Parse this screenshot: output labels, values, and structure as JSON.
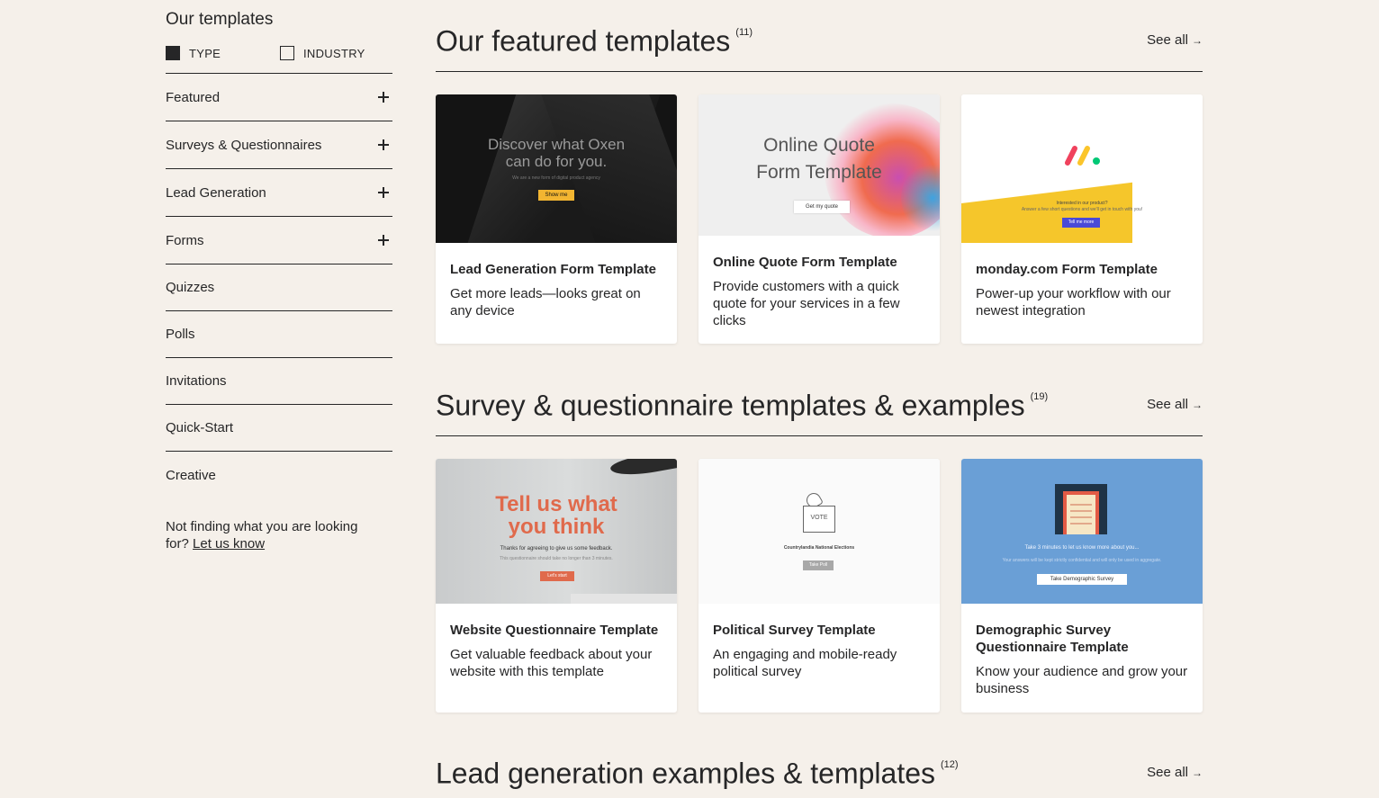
{
  "sidebar": {
    "title": "Our templates",
    "toggles": [
      {
        "label": "TYPE",
        "checked": true
      },
      {
        "label": "INDUSTRY",
        "checked": false
      }
    ],
    "categories": [
      {
        "label": "Featured",
        "expandable": true
      },
      {
        "label": "Surveys & Questionnaires",
        "expandable": true
      },
      {
        "label": "Lead Generation",
        "expandable": true
      },
      {
        "label": "Forms",
        "expandable": true
      },
      {
        "label": "Quizzes",
        "expandable": false
      },
      {
        "label": "Polls",
        "expandable": false
      },
      {
        "label": "Invitations",
        "expandable": false
      },
      {
        "label": "Quick-Start",
        "expandable": false
      },
      {
        "label": "Creative",
        "expandable": false
      }
    ],
    "not_finding_text": "Not finding what you are looking for?",
    "let_us_know": "Let us know"
  },
  "sections": [
    {
      "title": "Our featured templates",
      "count": "(11)",
      "see_all": "See all",
      "cards": [
        {
          "title": "Lead Generation Form Template",
          "desc": "Get more leads—looks great on any device",
          "thumb": {
            "headline": "Discover what Oxen can do for you.",
            "sub": "We are a new form of digital product agency",
            "button": "Show me"
          }
        },
        {
          "title": "Online Quote Form Template",
          "desc": "Provide customers with a quick quote for your services in a few clicks",
          "thumb": {
            "headline": "Online Quote Form Template",
            "button": "Get my quote"
          }
        },
        {
          "title": "monday.com Form Template",
          "desc": "Power-up your workflow with our newest integration",
          "thumb": {
            "line1": "Interested in our product?",
            "line2": "Answer a few short questions and we'll get in touch with you!",
            "button": "Tell me more"
          }
        }
      ]
    },
    {
      "title": "Survey & questionnaire templates & examples",
      "count": "(19)",
      "see_all": "See all",
      "cards": [
        {
          "title": "Website Questionnaire Template",
          "desc": "Get valuable feedback about your website with this template",
          "thumb": {
            "headline": "Tell us what you think",
            "sub": "Thanks for agreeing to give us some feedback.",
            "sub2": "This questionnaire should take no longer than 3 minutes.",
            "button": "Let's start"
          }
        },
        {
          "title": "Political Survey Template",
          "desc": "An engaging and mobile-ready political survey",
          "thumb": {
            "box": "VOTE",
            "line1": "Countrylandia National Elections",
            "button": "Take Poll"
          }
        },
        {
          "title": "Demographic Survey Questionnaire Template",
          "desc": "Know your audience and grow your business",
          "thumb": {
            "line1": "Take 3 minutes to let us know more about you...",
            "line2": "Your answers will be kept strictly confidential and will only be used in aggregate.",
            "button": "Take Demographic Survey"
          }
        }
      ]
    },
    {
      "title": "Lead generation examples & templates",
      "count": "(12)",
      "see_all": "See all"
    }
  ],
  "colors": {
    "background": "#f5f0ea",
    "text": "#262627",
    "oxen_button": "#f2b531",
    "monday_yellow": "#f5c62b",
    "website_accent": "#e06a4c",
    "demographic_blue": "#6a9fd6"
  },
  "icons": {
    "expand": "plus-icon",
    "see_all": "arrow-right-icon",
    "logo": "monday-logo-icon"
  }
}
